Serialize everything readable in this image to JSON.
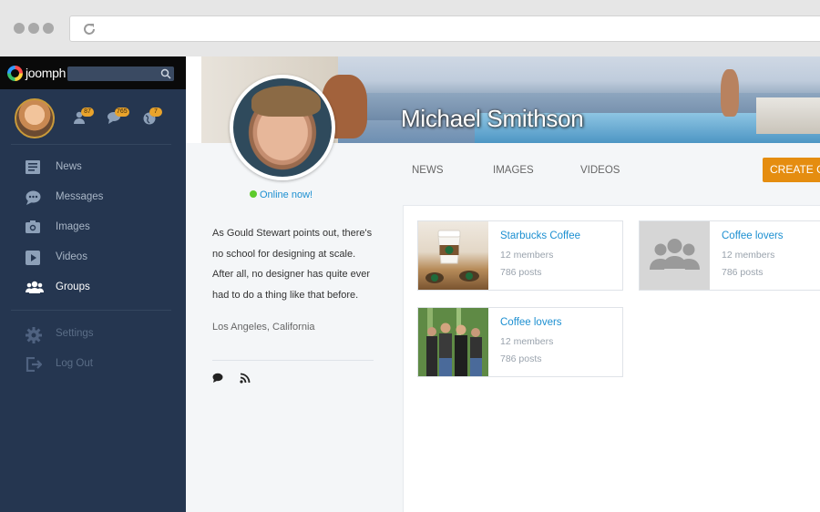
{
  "sidebar": {
    "logo": "joomph",
    "badges": {
      "friends": "87",
      "messages": "765",
      "globe": "7"
    },
    "nav": [
      {
        "label": "News",
        "icon": "news-icon"
      },
      {
        "label": "Messages",
        "icon": "messages-icon"
      },
      {
        "label": "Images",
        "icon": "camera-icon"
      },
      {
        "label": "Videos",
        "icon": "play-icon"
      },
      {
        "label": "Groups",
        "icon": "groups-icon"
      }
    ],
    "secondary": [
      {
        "label": "Settings",
        "icon": "gear-icon"
      },
      {
        "label": "Log Out",
        "icon": "logout-icon"
      }
    ]
  },
  "profile": {
    "name": "Michael Smithson",
    "status": "Online now!",
    "bio": "As Gould Stewart points out, there's no school for designing at scale. After all, no designer has quite ever had to do a thing like that before.",
    "location": "Los Angeles, California"
  },
  "tabs": [
    "NEWS",
    "IMAGES",
    "VIDEOS"
  ],
  "create_button": "CREATE GROUP",
  "groups": [
    {
      "title": "Starbucks Coffee",
      "members": "12 members",
      "posts": "786 posts"
    },
    {
      "title": "Coffee lovers",
      "members": "12 members",
      "posts": "786 posts"
    },
    {
      "title": "Coffee lovers",
      "members": "12 members",
      "posts": "786 posts"
    }
  ]
}
